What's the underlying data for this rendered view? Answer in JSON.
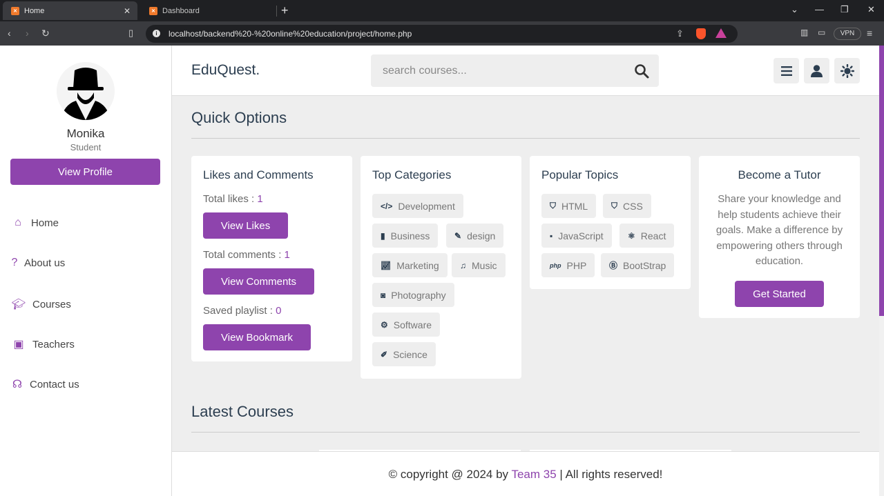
{
  "browser": {
    "tabs": [
      {
        "label": "Home",
        "active": true
      },
      {
        "label": "Dashboard",
        "active": false
      }
    ],
    "url": "localhost/backend%20-%20online%20education/project/home.php",
    "vpn_label": "VPN"
  },
  "sidebar": {
    "profile_name": "Monika",
    "profile_role": "Student",
    "view_profile": "View Profile",
    "nav": [
      {
        "label": "Home",
        "icon": "home-icon"
      },
      {
        "label": "About us",
        "icon": "question-icon"
      },
      {
        "label": "Courses",
        "icon": "graduation-cap-icon"
      },
      {
        "label": "Teachers",
        "icon": "chalkboard-teacher-icon"
      },
      {
        "label": "Contact us",
        "icon": "headset-icon"
      }
    ]
  },
  "header": {
    "logo": "EduQuest.",
    "search_placeholder": "search courses..."
  },
  "quick_options": {
    "title": "Quick Options",
    "likes_card": {
      "title": "Likes and Comments",
      "total_likes_label": "Total likes : ",
      "total_likes": "1",
      "view_likes": "View Likes",
      "total_comments_label": "Total comments : ",
      "total_comments": "1",
      "view_comments": "View Comments",
      "saved_playlist_label": "Saved playlist : ",
      "saved_playlist": "0",
      "view_bookmark": "View Bookmark"
    },
    "categories_card": {
      "title": "Top Categories",
      "items": [
        {
          "label": "Development",
          "icon": "code-icon"
        },
        {
          "label": "Business",
          "icon": "chart-icon"
        },
        {
          "label": "design",
          "icon": "pen-icon"
        },
        {
          "label": "Marketing",
          "icon": "line-chart-icon"
        },
        {
          "label": "Music",
          "icon": "music-icon"
        },
        {
          "label": "Photography",
          "icon": "camera-icon"
        },
        {
          "label": "Software",
          "icon": "gear-icon"
        },
        {
          "label": "Science",
          "icon": "vial-icon"
        }
      ]
    },
    "topics_card": {
      "title": "Popular Topics",
      "items": [
        {
          "label": "HTML",
          "icon": "html5-icon"
        },
        {
          "label": "CSS",
          "icon": "css3-icon"
        },
        {
          "label": "JavaScript",
          "icon": "js-icon"
        },
        {
          "label": "React",
          "icon": "react-icon"
        },
        {
          "label": "PHP",
          "icon": "php-icon"
        },
        {
          "label": "BootStrap",
          "icon": "bootstrap-icon"
        }
      ]
    },
    "tutor_card": {
      "title": "Become a Tutor",
      "text": "Share your knowledge and help students achieve their goals. Make a difference by empowering others through education.",
      "button": "Get Started"
    }
  },
  "latest_courses": {
    "title": "Latest Courses"
  },
  "footer": {
    "prefix": "© copyright @ 2024 by ",
    "team": "Team 35",
    "suffix": " | All rights reserved!"
  },
  "colors": {
    "accent": "#8e44ad",
    "heading": "#2c3e50",
    "background": "#eeeeee"
  }
}
